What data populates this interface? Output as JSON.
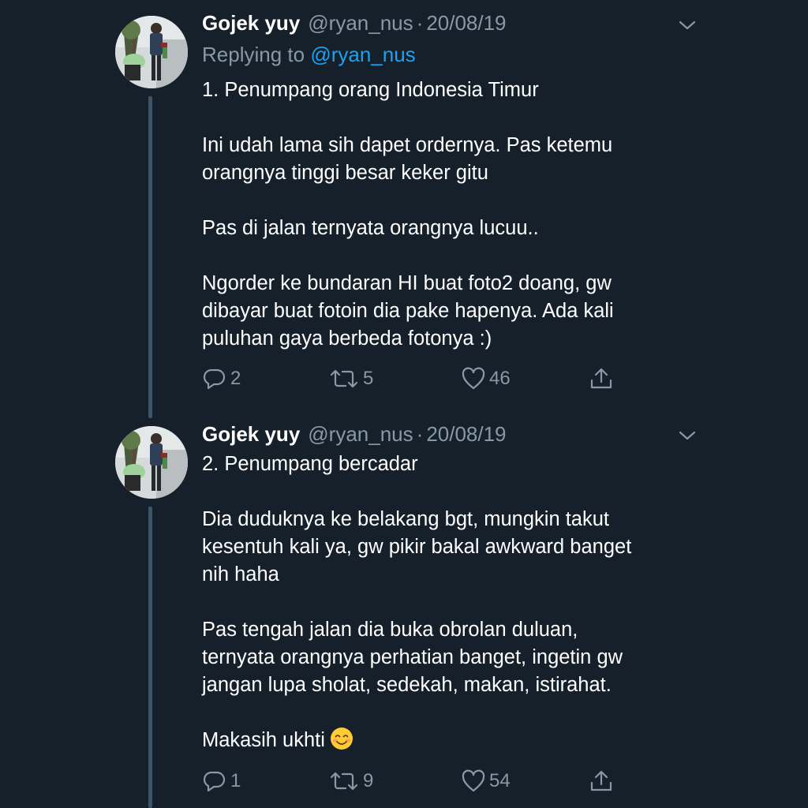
{
  "tweets": [
    {
      "name": "Gojek yuy",
      "handle": "@ryan_nus",
      "separator": "·",
      "date": "20/08/19",
      "replying_prefix": "Replying to",
      "replying_to": "@ryan_nus",
      "paragraphs": [
        "1. Penumpang orang Indonesia Timur",
        "Ini udah lama sih dapet ordernya. Pas ketemu\norangnya tinggi besar keker gitu",
        "Pas di jalan ternyata orangnya lucuu..",
        "Ngorder ke bundaran HI buat foto2 doang, gw\ndibayar buat fotoin dia pake hapenya. Ada kali\npuluhan gaya berbeda fotonya :)"
      ],
      "replies": "2",
      "retweets": "5",
      "likes": "46"
    },
    {
      "name": "Gojek yuy",
      "handle": "@ryan_nus",
      "separator": "·",
      "date": "20/08/19",
      "paragraphs": [
        "2. Penumpang bercadar",
        "Dia duduknya ke belakang bgt, mungkin takut\nkesentuh kali ya, gw pikir bakal awkward banget\nnih haha",
        "Pas tengah jalan dia buka obrolan duluan,\nternyata orangnya perhatian banget, ingetin gw\njangan lupa sholat, sedekah, makan, istirahat.",
        "Makasih ukhti"
      ],
      "emoji": "smiling-face-emoji",
      "replies": "1",
      "retweets": "9",
      "likes": "54"
    }
  ],
  "colors": {
    "background": "#15202b",
    "text": "#ffffff",
    "secondary": "#8899a6",
    "link": "#1da1f2",
    "thread_line": "#3d5466"
  },
  "icons": {
    "reply": "reply-icon",
    "retweet": "retweet-icon",
    "like": "heart-icon",
    "share": "share-icon",
    "menu": "chevron-down-icon"
  }
}
